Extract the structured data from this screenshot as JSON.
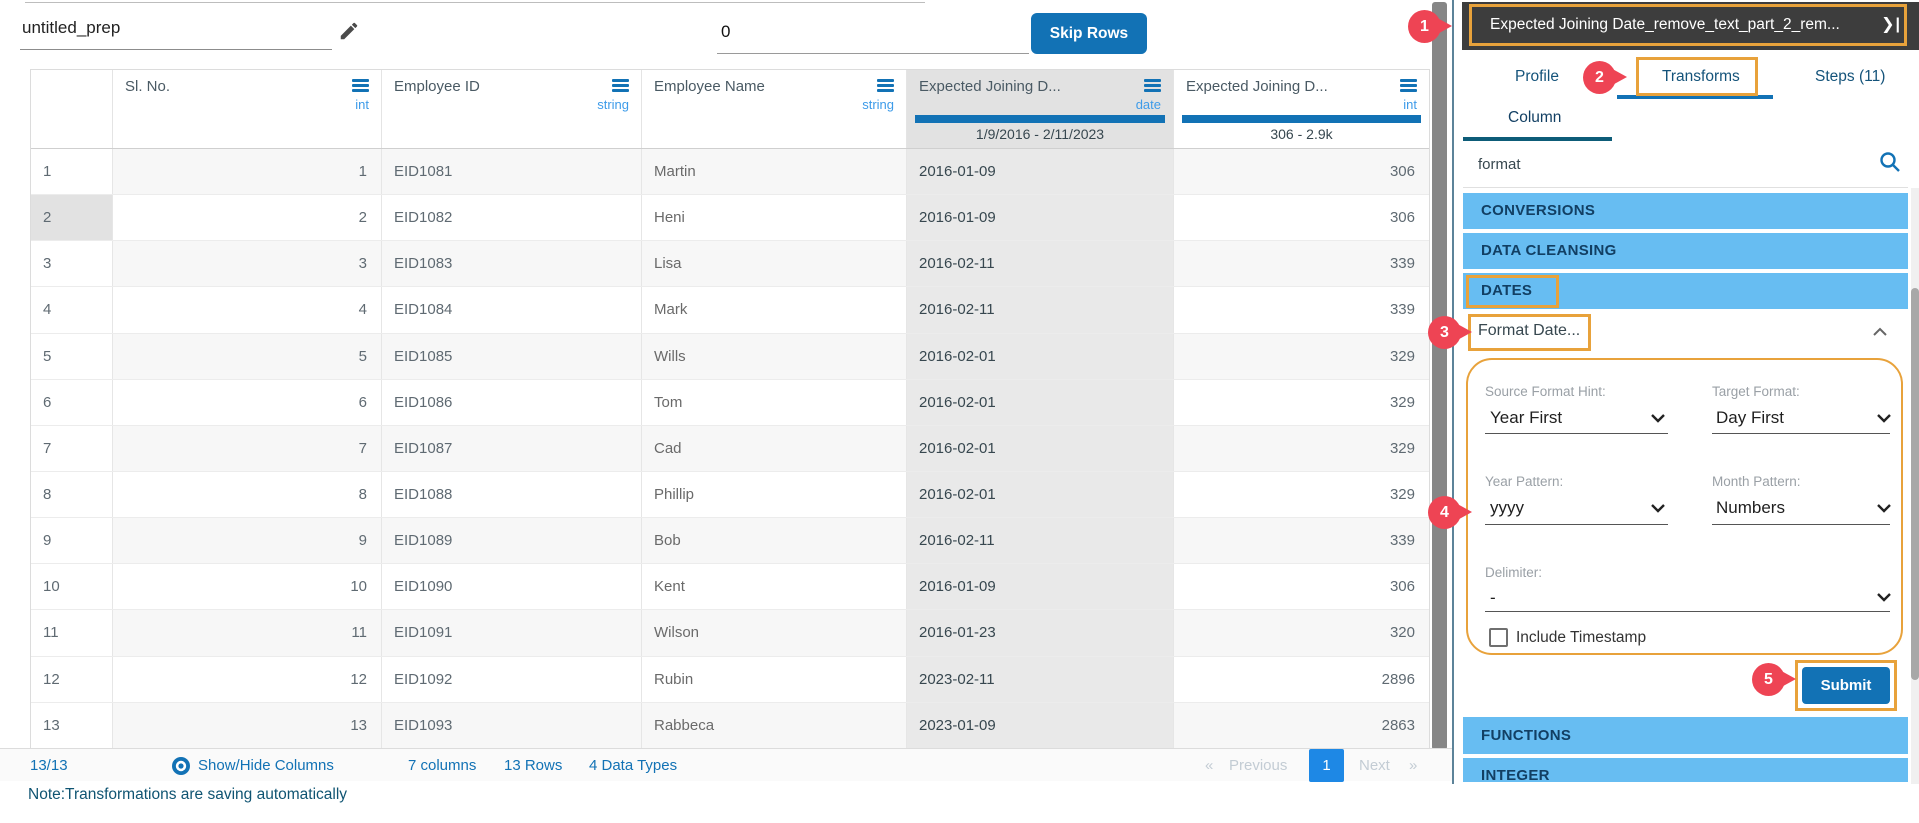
{
  "titlebar": {
    "prep_name": "untitled_prep",
    "skip_rows_value": "0",
    "skip_rows_label": "Skip Rows"
  },
  "table": {
    "columns": [
      {
        "title": "",
        "type": ""
      },
      {
        "title": "Sl. No.",
        "type": "int"
      },
      {
        "title": "Employee ID",
        "type": "string"
      },
      {
        "title": "Employee Name",
        "type": "string"
      },
      {
        "title": "Expected Joining D...",
        "type": "date",
        "range": "1/9/2016 - 2/11/2023"
      },
      {
        "title": "Expected Joining D...",
        "type": "int",
        "range": "306 - 2.9k"
      }
    ],
    "selected_row_num": "2",
    "rows": [
      {
        "num": "1",
        "sl": "1",
        "employee_id": "EID1081",
        "employee_name": "Martin",
        "expected_joining_date": "2016-01-09",
        "expected_joining_int": "306"
      },
      {
        "num": "2",
        "sl": "2",
        "employee_id": "EID1082",
        "employee_name": "Heni",
        "expected_joining_date": "2016-01-09",
        "expected_joining_int": "306"
      },
      {
        "num": "3",
        "sl": "3",
        "employee_id": "EID1083",
        "employee_name": "Lisa",
        "expected_joining_date": "2016-02-11",
        "expected_joining_int": "339"
      },
      {
        "num": "4",
        "sl": "4",
        "employee_id": "EID1084",
        "employee_name": "Mark",
        "expected_joining_date": "2016-02-11",
        "expected_joining_int": "339"
      },
      {
        "num": "5",
        "sl": "5",
        "employee_id": "EID1085",
        "employee_name": "Wills",
        "expected_joining_date": "2016-02-01",
        "expected_joining_int": "329"
      },
      {
        "num": "6",
        "sl": "6",
        "employee_id": "EID1086",
        "employee_name": "Tom",
        "expected_joining_date": "2016-02-01",
        "expected_joining_int": "329"
      },
      {
        "num": "7",
        "sl": "7",
        "employee_id": "EID1087",
        "employee_name": "Cad",
        "expected_joining_date": "2016-02-01",
        "expected_joining_int": "329"
      },
      {
        "num": "8",
        "sl": "8",
        "employee_id": "EID1088",
        "employee_name": "Phillip",
        "expected_joining_date": "2016-02-01",
        "expected_joining_int": "329"
      },
      {
        "num": "9",
        "sl": "9",
        "employee_id": "EID1089",
        "employee_name": "Bob",
        "expected_joining_date": "2016-02-11",
        "expected_joining_int": "339"
      },
      {
        "num": "10",
        "sl": "10",
        "employee_id": "EID1090",
        "employee_name": "Kent",
        "expected_joining_date": "2016-01-09",
        "expected_joining_int": "306"
      },
      {
        "num": "11",
        "sl": "11",
        "employee_id": "EID1091",
        "employee_name": "Wilson",
        "expected_joining_date": "2016-01-23",
        "expected_joining_int": "320"
      },
      {
        "num": "12",
        "sl": "12",
        "employee_id": "EID1092",
        "employee_name": "Rubin",
        "expected_joining_date": "2023-02-11",
        "expected_joining_int": "2896"
      },
      {
        "num": "13",
        "sl": "13",
        "employee_id": "EID1093",
        "employee_name": "Rabbeca",
        "expected_joining_date": "2023-01-09",
        "expected_joining_int": "2863"
      }
    ]
  },
  "statusbar": {
    "row_count": "13/13",
    "show_hide_label": "Show/Hide Columns",
    "columns_summary": "7 columns",
    "rows_summary": "13 Rows",
    "types_summary": "4 Data Types",
    "pagination": {
      "first": "«",
      "previous": "Previous",
      "page": "1",
      "next": "Next",
      "last": "»"
    },
    "note": "Note:Transformations are saving automatically"
  },
  "panel": {
    "title": "Expected Joining Date_remove_text_part_2_rem...",
    "collapse_icon_glyph": "❯|",
    "tabs": {
      "profile": "Profile",
      "transforms": "Transforms",
      "steps": "Steps (11)"
    },
    "subtab": "Column",
    "search_value": "format",
    "sections": {
      "conversions": "CONVERSIONS",
      "data_cleansing": "DATA CLEANSING",
      "dates": "DATES",
      "functions": "FUNCTIONS",
      "integer": "INTEGER"
    },
    "transform_item": "Format Date...",
    "form": {
      "source_format_hint_label": "Source Format Hint:",
      "source_format_hint_value": "Year First",
      "target_format_label": "Target Format:",
      "target_format_value": "Day First",
      "year_pattern_label": "Year Pattern:",
      "year_pattern_value": "yyyy",
      "month_pattern_label": "Month Pattern:",
      "month_pattern_value": "Numbers",
      "delimiter_label": "Delimiter:",
      "delimiter_value": "-",
      "include_timestamp_label": "Include Timestamp",
      "submit_label": "Submit"
    },
    "annotations": {
      "step1": "1",
      "step2": "2",
      "step3": "3",
      "step4": "4",
      "step5": "5"
    }
  },
  "colors": {
    "primary_blue": "#1272b5",
    "type_blue": "#3d9be9",
    "section_blue": "#67bdf2",
    "highlight_orange": "#e8a23b",
    "badge_red": "#ee4454",
    "dark_bar": "#3d3d3d",
    "navy_text": "#123f63"
  }
}
